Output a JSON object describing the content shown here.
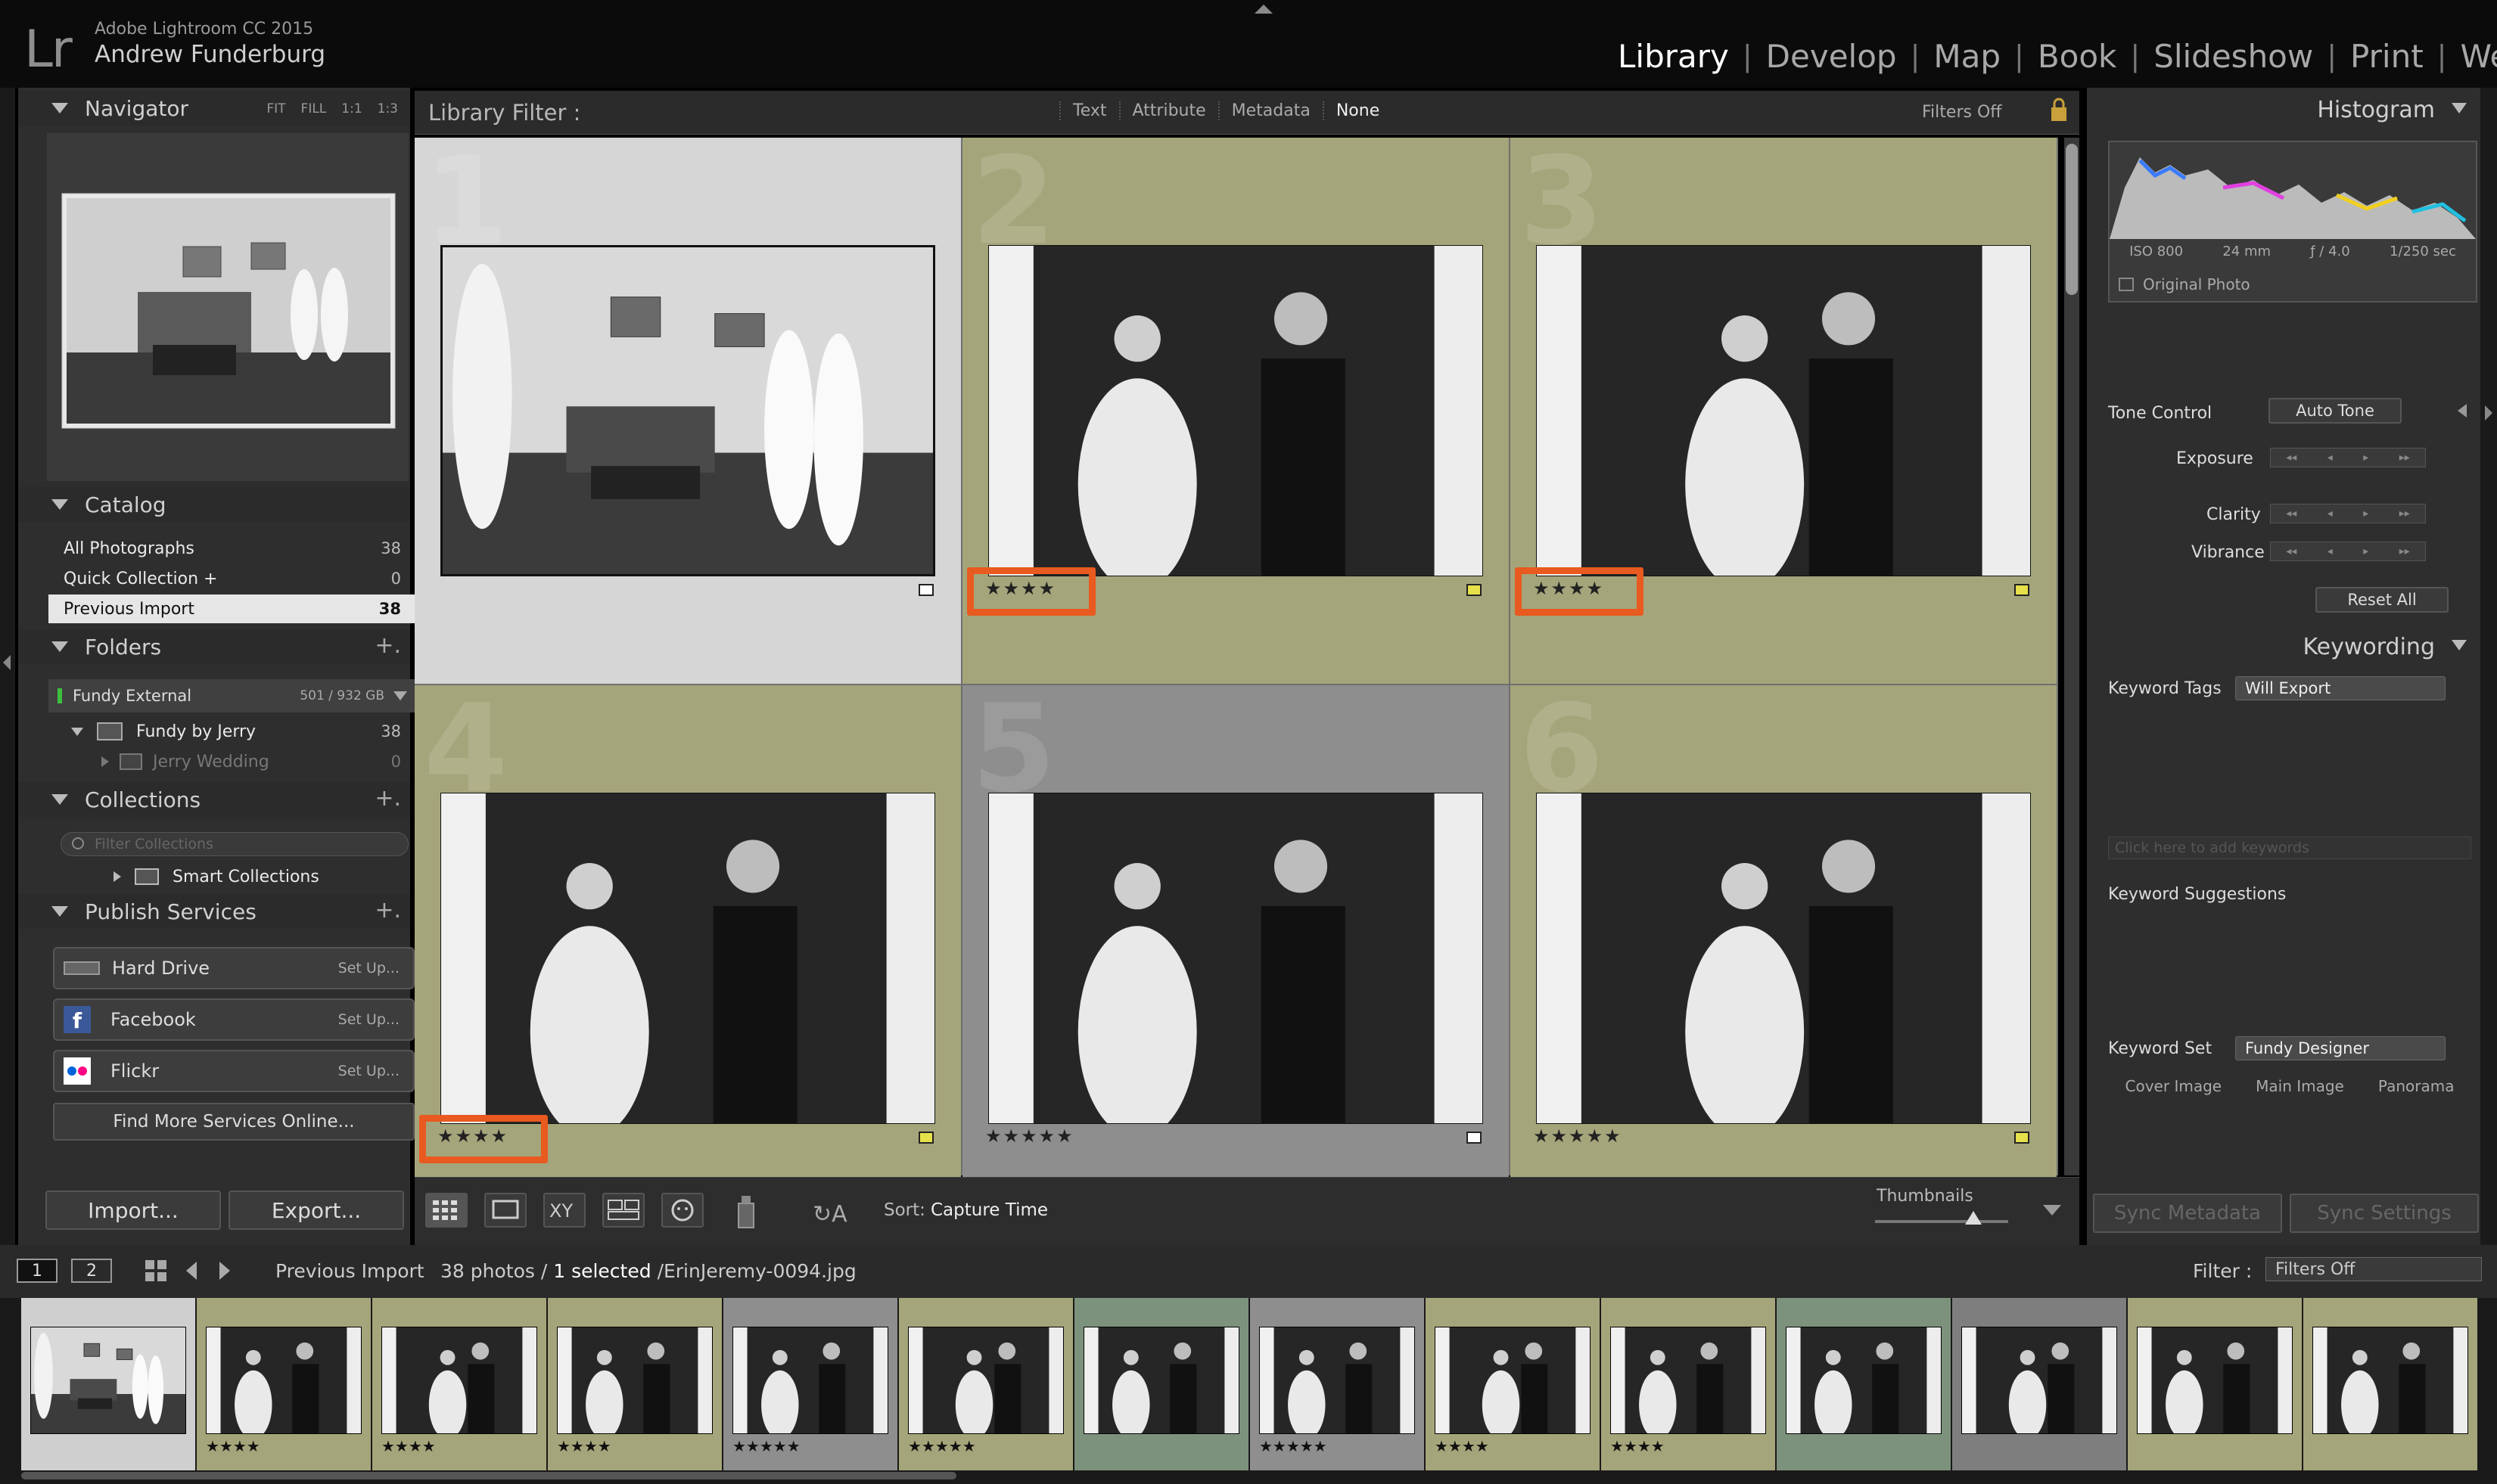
{
  "app": {
    "logo": "Lr",
    "version": "Adobe Lightroom CC 2015",
    "user": "Andrew Funderburg"
  },
  "modules": [
    "Library",
    "Develop",
    "Map",
    "Book",
    "Slideshow",
    "Print",
    "We"
  ],
  "active_module": "Library",
  "left_panel": {
    "navigator": {
      "title": "Navigator",
      "options": [
        "FIT",
        "FILL",
        "1:1",
        "1:3"
      ]
    },
    "catalog": {
      "title": "Catalog",
      "items": [
        {
          "label": "All Photographs",
          "count": "38"
        },
        {
          "label": "Quick Collection +",
          "count": "0"
        },
        {
          "label": "Previous Import",
          "count": "38"
        }
      ]
    },
    "folders": {
      "title": "Folders",
      "drive": {
        "label": "Fundy External",
        "size": "501 / 932 GB"
      },
      "items": [
        {
          "label": "Fundy by Jerry",
          "count": "38"
        },
        {
          "label": "Jerry Wedding",
          "count": "0"
        }
      ]
    },
    "collections": {
      "title": "Collections",
      "filter_placeholder": "Filter Collections",
      "items": [
        {
          "label": "Smart Collections"
        }
      ]
    },
    "publish": {
      "title": "Publish Services",
      "items": [
        {
          "label": "Hard Drive",
          "action": "Set Up..."
        },
        {
          "label": "Facebook",
          "action": "Set Up..."
        },
        {
          "label": "Flickr",
          "action": "Set Up..."
        }
      ],
      "find_more": "Find More Services Online..."
    },
    "import_label": "Import...",
    "export_label": "Export..."
  },
  "filter_bar": {
    "title": "Library Filter :",
    "options": [
      "Text",
      "Attribute",
      "Metadata",
      "None"
    ],
    "active": "None",
    "status": "Filters Off"
  },
  "grid": {
    "cells": [
      {
        "num": "1",
        "stars": "",
        "flag": "white",
        "bg": "#d6d6d6",
        "highlight": false
      },
      {
        "num": "2",
        "stars": "★★★★",
        "flag": "yellow",
        "bg": "#a5a57b",
        "highlight": true
      },
      {
        "num": "3",
        "stars": "★★★★",
        "flag": "yellow",
        "bg": "#a5a57b",
        "highlight": true
      },
      {
        "num": "4",
        "stars": "★★★★",
        "flag": "yellow",
        "bg": "#a5a57b",
        "highlight": true
      },
      {
        "num": "5",
        "stars": "★★★★★",
        "flag": "white",
        "bg": "#8e8e8e",
        "highlight": false
      },
      {
        "num": "6",
        "stars": "★★★★★",
        "flag": "yellow",
        "bg": "#a5a57b",
        "highlight": false
      }
    ]
  },
  "toolbar": {
    "sort_label": "Sort:",
    "sort_value": "Capture Time",
    "thumbnails_label": "Thumbnails",
    "thumbnail_size": 0.74
  },
  "right_panel": {
    "histogram": {
      "title": "Histogram",
      "iso": "ISO 800",
      "focal": "24 mm",
      "aperture": "ƒ / 4.0",
      "shutter": "1/250 sec",
      "original_photo": "Original Photo"
    },
    "tone_control_label": "Tone Control",
    "auto_tone": "Auto Tone",
    "sliders": [
      "Exposure",
      "Clarity",
      "Vibrance"
    ],
    "reset_all": "Reset All",
    "keywording": {
      "title": "Keywording",
      "tags_label": "Keyword Tags",
      "tags_value": "Will Export",
      "placeholder": "Click here to add keywords",
      "suggestions": "Keyword Suggestions",
      "set_label": "Keyword Set",
      "set_value": "Fundy Designer",
      "set_items": [
        "Cover Image",
        "Main Image",
        "Panorama"
      ]
    },
    "sync_metadata": "Sync Metadata",
    "sync_settings": "Sync Settings"
  },
  "filmstrip_bar": {
    "monitor1": "1",
    "monitor2": "2",
    "source": "Previous Import",
    "count_text": "38 photos /",
    "selected_text": "1 selected",
    "file_text": "/ErinJeremy-0094.jpg",
    "filter_label": "Filter :",
    "filter_value": "Filters Off"
  },
  "filmstrip": [
    {
      "stars": "",
      "bg": "#cfcfcf"
    },
    {
      "stars": "★★★★",
      "bg": "#a5a57b"
    },
    {
      "stars": "★★★★",
      "bg": "#a5a57b"
    },
    {
      "stars": "★★★★",
      "bg": "#a5a57b"
    },
    {
      "stars": "★★★★★",
      "bg": "#8e8e8e"
    },
    {
      "stars": "★★★★★",
      "bg": "#a5a57b"
    },
    {
      "stars": "",
      "bg": "#7c927c"
    },
    {
      "stars": "★★★★★",
      "bg": "#8e8e8e"
    },
    {
      "stars": "★★★★",
      "bg": "#a5a57b"
    },
    {
      "stars": "★★★★",
      "bg": "#a5a57b"
    },
    {
      "stars": "",
      "bg": "#7c927c"
    },
    {
      "stars": "",
      "bg": "#7e7e7e"
    },
    {
      "stars": "",
      "bg": "#a5a57b"
    },
    {
      "stars": "",
      "bg": "#a5a57b"
    }
  ]
}
